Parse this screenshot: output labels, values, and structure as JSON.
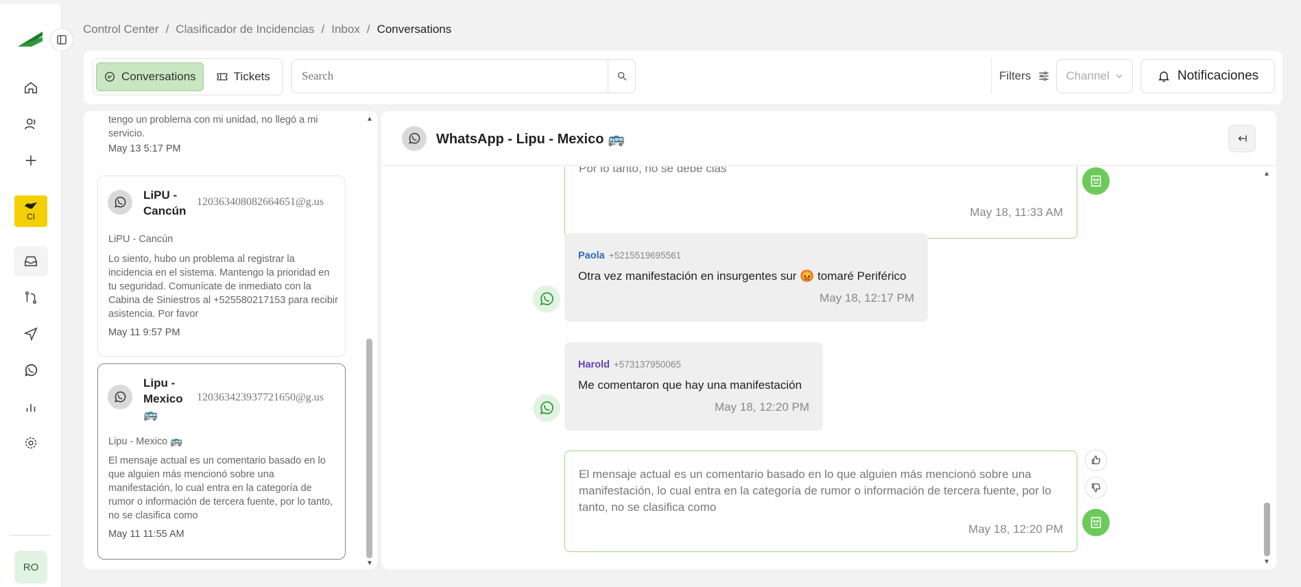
{
  "rail": {
    "items": [
      "home-icon",
      "contacts-icon",
      "add-icon",
      "inbox-icon",
      "flows-icon",
      "send-icon",
      "whatsapp-icon",
      "analytics-icon",
      "settings-icon"
    ],
    "ci_label": "CI",
    "avatar_initials": "RO"
  },
  "breadcrumb": [
    "Control Center",
    "Clasificador de Incidencias",
    "Inbox",
    "Conversations"
  ],
  "toolbar": {
    "tab_conversations": "Conversations",
    "tab_tickets": "Tickets",
    "search_placeholder": "Search",
    "filters_label": "Filters",
    "channel_label": "Channel",
    "notifications_label": "Notificaciones"
  },
  "conversations": [
    {
      "preview": "tengo un problema con mi unidad, no llegó a mi servicio.",
      "date": "May 13 5:17 PM"
    },
    {
      "name": "LiPU - Cancún",
      "phone": "120363408082664651@g.us",
      "subtitle": "LiPU - Cancún",
      "preview": "Lo siento, hubo un problema al registrar la incidencia en el sistema. Mantengo la prioridad en tu seguridad. Comunícate de inmediato con la Cabina de Siniestros al +525580217153 para recibir asistencia. Por favor",
      "date": "May 11 9:57 PM"
    },
    {
      "name": "Lipu - Mexico 🚌",
      "phone": "120363423937721650@g.us",
      "subtitle": "Lipu - Mexico 🚌",
      "preview": "El mensaje actual es un comentario basado en lo que alguien más mencionó sobre una manifestación, lo cual entra en la categoría de rumor o información de tercera fuente, por lo tanto, no se clasifica como",
      "date": "May 11 11:55 AM"
    }
  ],
  "chat": {
    "title": "WhatsApp - Lipu - Mexico 🚌",
    "messages": [
      {
        "type": "bot",
        "text": "Por lo tanto, no se debe clas",
        "time": "May 18, 11:33 AM"
      },
      {
        "type": "human",
        "sender": "Paola",
        "sender_color": "#2e6bb5",
        "number": "+5215519695561",
        "text": "Otra vez manifestación en insurgentes sur 😡 tomaré Periférico",
        "time": "May 18, 12:17 PM"
      },
      {
        "type": "human",
        "sender": "Harold",
        "sender_color": "#6a3fb5",
        "number": "+573137950065",
        "text": "Me comentaron que hay una manifestación",
        "time": "May 18, 12:20 PM"
      },
      {
        "type": "bot",
        "text": "El mensaje actual es un comentario basado en lo que alguien más mencionó sobre una manifestación, lo cual entra en la categoría de rumor o información de tercera fuente, por lo tanto, no se clasifica como",
        "time": "May 18, 12:20 PM"
      }
    ]
  },
  "colors": {
    "accent": "#c8e6c2",
    "brand_green": "#1f7a2a",
    "bot_border": "#9cd48a",
    "bot_icon": "#6cc95a",
    "ci_yellow": "#f5d000"
  }
}
